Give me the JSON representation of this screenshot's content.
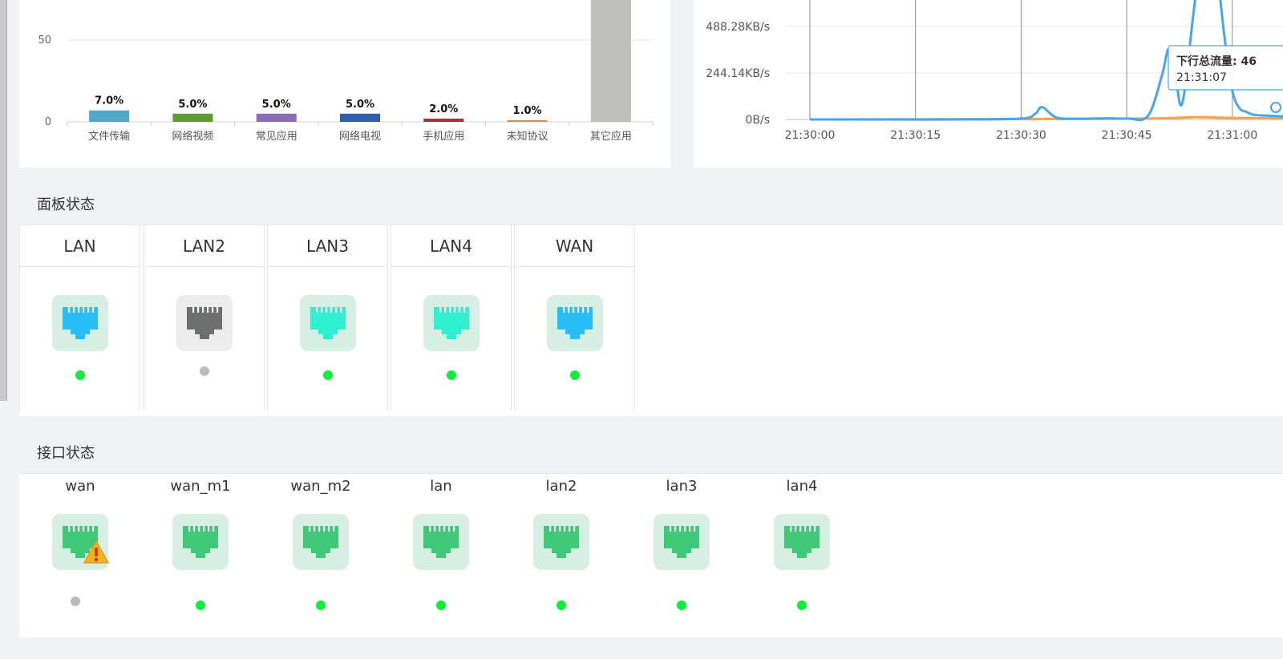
{
  "colors": {
    "online": "#11ee3a",
    "offline": "#b9bcbf",
    "lan_blue": "#28bdf6",
    "lan_cyan": "#2ef0d0",
    "lan_gray": "#6d6f6f",
    "iface_green": "#3fc878",
    "series_down": "#45a6ee",
    "series_up": "#f7a24f"
  },
  "chart_data": [
    {
      "type": "bar",
      "categories": [
        "文件传输",
        "网络视频",
        "常见应用",
        "网络电视",
        "手机应用",
        "未知协议",
        "其它应用"
      ],
      "values": [
        7.0,
        5.0,
        5.0,
        5.0,
        2.0,
        1.0,
        75.0
      ],
      "labels": [
        "7.0%",
        "5.0%",
        "5.0%",
        "5.0%",
        "2.0%",
        "1.0%",
        ""
      ],
      "colors": [
        "#4fa8c8",
        "#5e9a2d",
        "#8d6db5",
        "#2f5fac",
        "#b3283c",
        "#e08a45",
        "#bfbfbe"
      ],
      "y_ticks": [
        "0",
        "50"
      ],
      "ylim": [
        0,
        100
      ],
      "grid": true
    },
    {
      "type": "line",
      "x_ticks": [
        "21:30:00",
        "21:30:15",
        "21:30:30",
        "21:30:45",
        "21:31:00"
      ],
      "y_ticks": [
        "0B/s",
        "244.14KB/s",
        "488.28KB/s"
      ],
      "series": [
        {
          "color": "#45a6ee",
          "points_sec": [
            0,
            10,
            20,
            30,
            32,
            33,
            35,
            38,
            42,
            45,
            48,
            50,
            51,
            52,
            53,
            55,
            57,
            59,
            60,
            61,
            62,
            63,
            65,
            68,
            70
          ],
          "points_kbps": [
            0,
            0,
            0,
            5,
            30,
            65,
            10,
            4,
            6,
            5,
            18,
            230,
            370,
            200,
            100,
            700,
            950,
            400,
            150,
            60,
            40,
            25,
            20,
            15,
            10
          ]
        },
        {
          "color": "#f7a24f",
          "points_sec": [
            0,
            30,
            40,
            50,
            55,
            60,
            70
          ],
          "points_kbps": [
            0,
            2,
            3,
            6,
            12,
            8,
            6
          ]
        }
      ],
      "tooltip": {
        "label": "下行总流量: 46",
        "time": "21:31:07"
      },
      "grid": true
    }
  ],
  "panel": {
    "title": "面板状态",
    "ports": [
      {
        "name": "LAN",
        "state": "on",
        "tone": "lan_blue"
      },
      {
        "name": "LAN2",
        "state": "off",
        "tone": "lan_gray"
      },
      {
        "name": "LAN3",
        "state": "on",
        "tone": "lan_cyan"
      },
      {
        "name": "LAN4",
        "state": "on",
        "tone": "lan_cyan"
      },
      {
        "name": "WAN",
        "state": "on",
        "tone": "lan_blue"
      }
    ]
  },
  "interfaces": {
    "title": "接口状态",
    "items": [
      {
        "name": "wan",
        "state": "off",
        "warning": true
      },
      {
        "name": "wan_m1",
        "state": "on",
        "warning": false
      },
      {
        "name": "wan_m2",
        "state": "on",
        "warning": false
      },
      {
        "name": "lan",
        "state": "on",
        "warning": false
      },
      {
        "name": "lan2",
        "state": "on",
        "warning": false
      },
      {
        "name": "lan3",
        "state": "on",
        "warning": false
      },
      {
        "name": "lan4",
        "state": "on",
        "warning": false
      }
    ]
  }
}
